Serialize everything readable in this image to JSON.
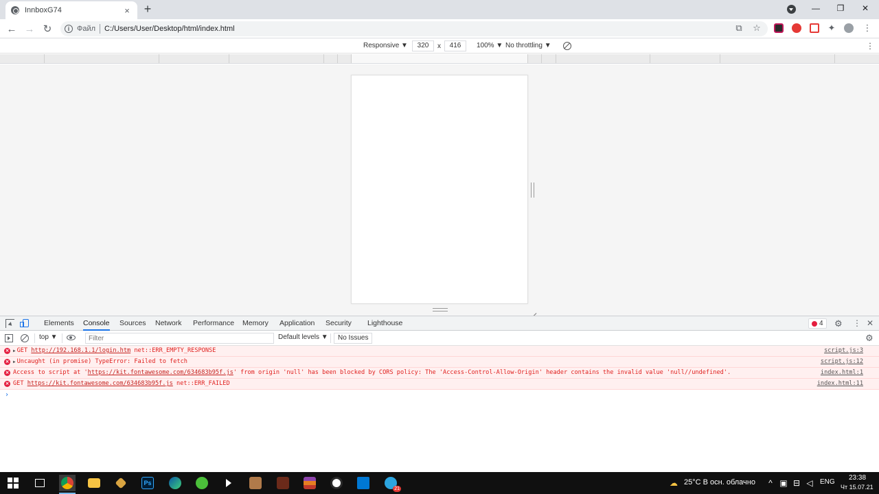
{
  "browser": {
    "tab_title": "InnboxG74",
    "tab_close": "×",
    "new_tab": "+",
    "scheme_label": "Файл",
    "url": "C:/Users/User/Desktop/html/index.html",
    "win_min": "—",
    "win_restore": "❐",
    "win_close": "✕",
    "nav_back": "←",
    "nav_forward": "→",
    "nav_reload": "↻",
    "star": "☆",
    "translate": "⧉",
    "puzzle": "✦",
    "kebab": "⋮"
  },
  "device_toolbar": {
    "device": "Responsive ▼",
    "width": "320",
    "times": "x",
    "height": "416",
    "zoom": "100% ▼",
    "throttling": "No throttling ▼",
    "kebab": "⋮"
  },
  "devtools": {
    "tabs": [
      "Elements",
      "Console",
      "Sources",
      "Network",
      "Performance",
      "Memory",
      "Application",
      "Security",
      "Lighthouse"
    ],
    "active_tab": "Console",
    "error_count": "4",
    "gear": "⚙",
    "kebab": "⋮",
    "close": "✕",
    "context": "top ▼",
    "filter_placeholder": "Filter",
    "levels": "Default levels ▼",
    "issues": "No Issues",
    "prompt": "›"
  },
  "console_logs": [
    {
      "prefix": "GET ",
      "link": "http://192.168.1.1/login.htm",
      "suffix": " net::ERR_EMPTY_RESPONSE",
      "source": "script.js:3",
      "expandable": true
    },
    {
      "prefix": "Uncaught (in promise) TypeError: Failed to fetch",
      "link": "",
      "suffix": "",
      "source": "script.js:12",
      "expandable": true
    },
    {
      "prefix": "Access to script at '",
      "link": "https://kit.fontawesome.com/634683b95f.js",
      "suffix": "' from origin 'null' has been blocked by CORS policy: The 'Access-Control-Allow-Origin' header contains the invalid value 'null//undefined'.",
      "source": "index.html:1",
      "expandable": false
    },
    {
      "prefix": "GET ",
      "link": "https://kit.fontawesome.com/634683b95f.js",
      "suffix": " net::ERR_FAILED",
      "source": "index.html:11",
      "expandable": false
    }
  ],
  "taskbar": {
    "weather": "25°C  В осн. облачно",
    "language": "ENG",
    "time": "23:38",
    "date": "Чт 15.07.21",
    "tray_up": "^",
    "vscode_badge": "21"
  },
  "colors": {
    "error_red": "#e41e3f",
    "accent_blue": "#1a73e8",
    "taskbar_bg": "#101010"
  }
}
